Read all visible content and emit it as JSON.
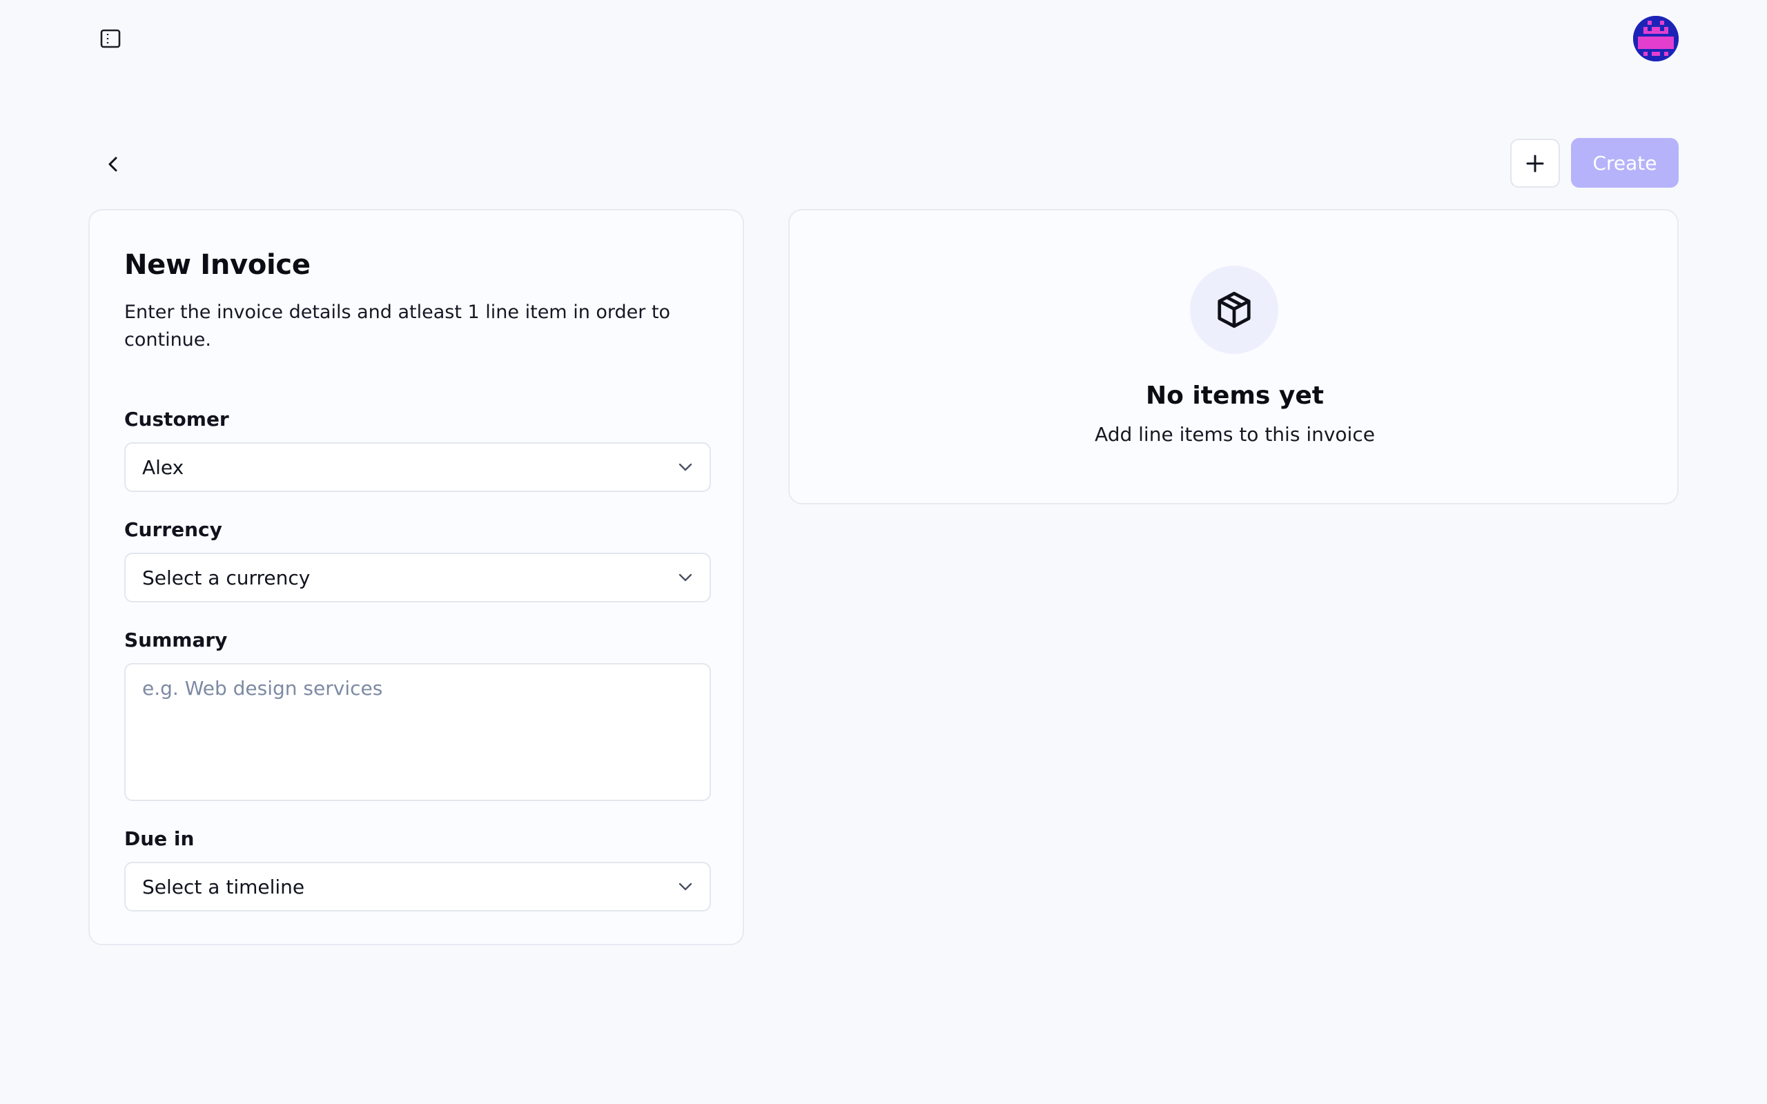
{
  "header": {
    "sidebar_toggle_icon": "sidebar-panel-icon",
    "avatar_icon": "pixel-avatar-icon"
  },
  "toolbar": {
    "back_icon": "chevron-left-icon",
    "add_icon": "plus-icon",
    "create_label": "Create",
    "create_color": "#b6b3fb"
  },
  "form": {
    "title": "New Invoice",
    "description": "Enter the invoice details and atleast 1 line item in order to continue.",
    "customer": {
      "label": "Customer",
      "value": "Alex"
    },
    "currency": {
      "label": "Currency",
      "value": "Select a currency"
    },
    "summary": {
      "label": "Summary",
      "placeholder": "e.g. Web design services"
    },
    "due": {
      "label": "Due in",
      "value": "Select a timeline"
    }
  },
  "items": {
    "icon": "package-icon",
    "empty_title": "No items yet",
    "empty_subtitle": "Add line items to this invoice"
  }
}
